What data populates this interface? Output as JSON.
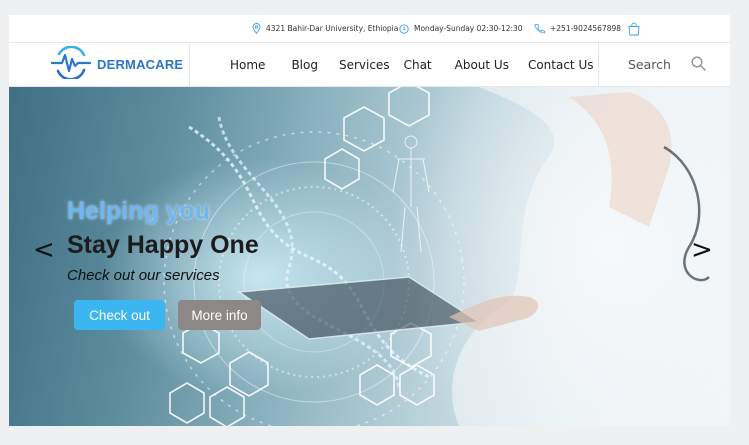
{
  "topbar": {
    "address": "4321 Bahir-Dar University, Ethiopia",
    "hours": "Monday-Sunday  02:30-12:30",
    "phone": "+251-9024567898"
  },
  "brand": {
    "name": "DERMACARE"
  },
  "nav": {
    "items": [
      {
        "label": "Home"
      },
      {
        "label": "Blog"
      },
      {
        "label": "Services"
      },
      {
        "label": "Chat"
      },
      {
        "label": "About Us"
      },
      {
        "label": "Contact Us"
      }
    ],
    "search_label": "Search"
  },
  "hero": {
    "title_line1": "Helping you",
    "title_line2": "Stay Happy One",
    "subtitle": "Check out our services",
    "primary_button": "Check out",
    "secondary_button": "More info",
    "prev_arrow": "<",
    "next_arrow": ">"
  },
  "colors": {
    "brand": "#2a78c9",
    "primary_button": "#3bb6f0",
    "secondary_button": "#8d8885",
    "accent_title": "#6fb6f2"
  },
  "icons": [
    "location-pin-icon",
    "clock-icon",
    "phone-icon",
    "shopping-bag-icon",
    "heartbeat-logo-icon",
    "search-icon",
    "chevron-left-icon",
    "chevron-right-icon"
  ]
}
